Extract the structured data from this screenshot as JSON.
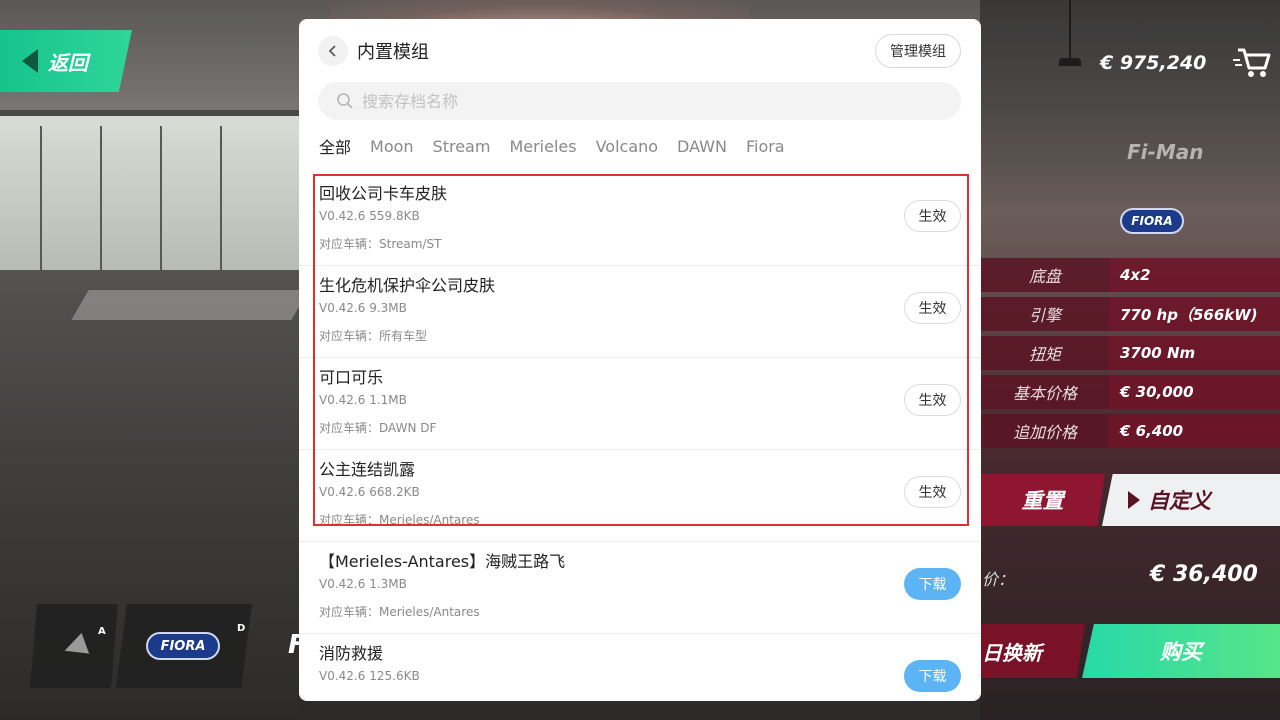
{
  "background": {
    "back_label": "返回",
    "money": "€ 975,240",
    "car_name": "Fi-Man",
    "brand_badge": "FIORA",
    "stats": [
      {
        "label": "底盘",
        "value": "4x2"
      },
      {
        "label": "引擎",
        "value": "770 hp（566kW)"
      },
      {
        "label": "扭矩",
        "value": "3700 Nm"
      },
      {
        "label": "基本价格",
        "value": "€ 30,000"
      },
      {
        "label": "追加价格",
        "value": "€ 6,400"
      }
    ],
    "reset_label": "重置",
    "custom_label": "自定义",
    "total_label": "价：",
    "total_price": "€ 36,400",
    "tradein_label": "日换新",
    "buy_label": "购买",
    "selector": {
      "key_a": "A",
      "key_d": "D",
      "badge": "FIORA",
      "letter": "F"
    }
  },
  "dialog": {
    "title": "内置模组",
    "manage_label": "管理模组",
    "search_placeholder": "搜索存档名称",
    "tabs": [
      "全部",
      "Moon",
      "Stream",
      "Merieles",
      "Volcano",
      "DAWN",
      "Fiora"
    ],
    "items": [
      {
        "name": "回收公司卡车皮肤",
        "version": "V0.42.6",
        "size": "559.8KB",
        "vehicle": "对应车辆：Stream/ST",
        "action": "生效"
      },
      {
        "name": "生化危机保护伞公司皮肤",
        "version": "V0.42.6",
        "size": "9.3MB",
        "vehicle": "对应车辆：所有车型",
        "action": "生效"
      },
      {
        "name": "可口可乐",
        "version": "V0.42.6",
        "size": "1.1MB",
        "vehicle": "对应车辆：DAWN DF",
        "action": "生效"
      },
      {
        "name": "公主连结凯露",
        "version": "V0.42.6",
        "size": "668.2KB",
        "vehicle": "对应车辆：Merieles/Antares",
        "action": "生效"
      },
      {
        "name": "【Merieles-Antares】海贼王路飞",
        "version": "V0.42.6",
        "size": "1.3MB",
        "vehicle": "对应车辆：Merieles/Antares",
        "action": "下载"
      },
      {
        "name": "消防救援",
        "version": "V0.42.6",
        "size": "125.6KB",
        "vehicle": "",
        "action": "下载"
      }
    ]
  },
  "colors": {
    "highlight": "#e3302f",
    "download": "#5db4f4",
    "green_accent": "#27d9a8",
    "crimson": "#8e1630"
  }
}
